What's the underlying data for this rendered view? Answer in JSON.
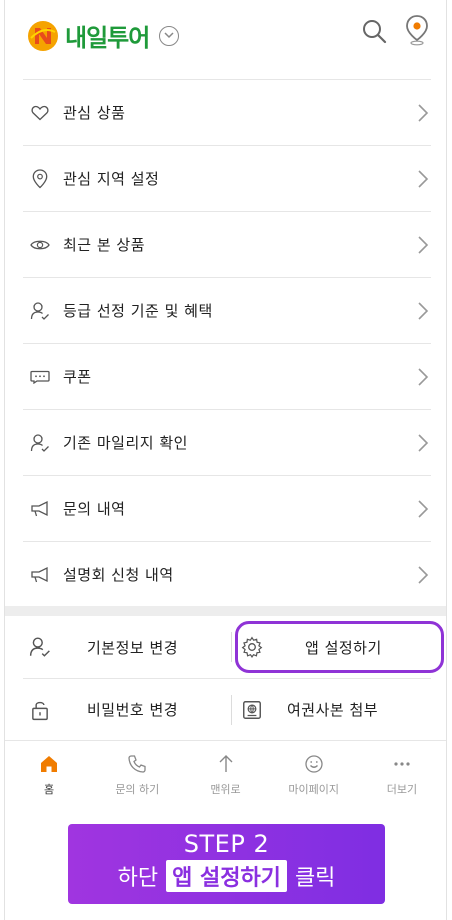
{
  "header": {
    "logo_text": "내일투어",
    "brand_color": "#1f9a3a",
    "icons": [
      "chevron-down-icon",
      "search-icon",
      "location-pin-icon"
    ]
  },
  "menu": {
    "items": [
      {
        "label": "관심 상품",
        "icon": "heart-icon"
      },
      {
        "label": "관심 지역 설정",
        "icon": "location-icon"
      },
      {
        "label": "최근 본 상품",
        "icon": "eye-icon"
      },
      {
        "label": "등급 선정 기준 및 혜택",
        "icon": "user-check-icon"
      },
      {
        "label": "쿠폰",
        "icon": "coupon-icon"
      },
      {
        "label": "기존 마일리지 확인",
        "icon": "user-check-icon"
      },
      {
        "label": "문의 내역",
        "icon": "megaphone-icon"
      },
      {
        "label": "설명회 신청 내역",
        "icon": "megaphone-icon"
      }
    ]
  },
  "account": {
    "profile_label": "기본정보 변경",
    "app_settings_label": "앱 설정하기",
    "password_label": "비밀번호 변경",
    "passport_label": "여권사본 첨부",
    "highlight_color": "#8f33d6"
  },
  "tabbar": {
    "tabs": [
      {
        "label": "홈",
        "icon": "home-icon",
        "active": true
      },
      {
        "label": "문의 하기",
        "icon": "phone-icon",
        "active": false
      },
      {
        "label": "맨위로",
        "icon": "arrow-up-icon",
        "active": false
      },
      {
        "label": "마이페이지",
        "icon": "smile-icon",
        "active": false
      },
      {
        "label": "더보기",
        "icon": "more-icon",
        "active": false
      }
    ],
    "active_color": "#f07c00"
  },
  "banner": {
    "step": "STEP 2",
    "prefix": "하단",
    "highlight": "앱 설정하기",
    "suffix": "클릭",
    "color": "#8f33e0"
  }
}
